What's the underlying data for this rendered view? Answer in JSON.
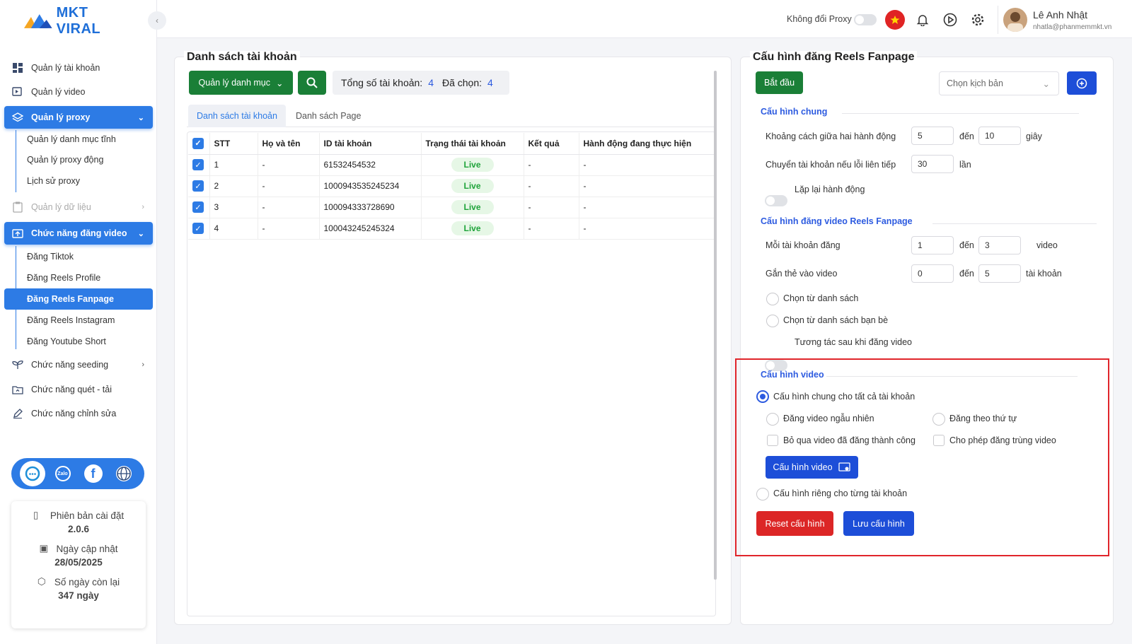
{
  "app": {
    "logo_text": "MKT VIRAL"
  },
  "sidebar": {
    "items": [
      {
        "label": "Quản lý tài khoản"
      },
      {
        "label": "Quản lý video"
      },
      {
        "label": "Quản lý proxy"
      },
      {
        "label": "Quản lý danh mục tĩnh"
      },
      {
        "label": "Quản lý proxy động"
      },
      {
        "label": "Lịch sử proxy"
      },
      {
        "label": "Quản lý dữ liệu"
      },
      {
        "label": "Chức năng đăng video"
      },
      {
        "label": "Đăng Tiktok"
      },
      {
        "label": "Đăng Reels Profile"
      },
      {
        "label": "Đăng Reels Fanpage"
      },
      {
        "label": "Đăng Reels Instagram"
      },
      {
        "label": "Đăng Youtube Short"
      },
      {
        "label": "Chức năng seeding"
      },
      {
        "label": "Chức năng quét - tải"
      },
      {
        "label": "Chức năng chỉnh sửa"
      }
    ],
    "social": {
      "zalo": "Zalo"
    },
    "info": {
      "version_label": "Phiên bản cài đặt",
      "version": "2.0.6",
      "update_label": "Ngày cập nhật",
      "update_date": "28/05/2025",
      "days_label": "Số ngày còn lại",
      "days": "347 ngày"
    }
  },
  "header": {
    "proxy_label": "Không đổi Proxy",
    "user_name": "Lê Anh Nhật",
    "user_email": "nhatla@phanmemmkt.vn"
  },
  "accounts": {
    "title": "Danh sách tài khoản",
    "category_btn": "Quản lý danh mục",
    "total_label": "Tổng số tài khoản:",
    "total": "4",
    "selected_label": "Đã chọn:",
    "selected": "4",
    "tabs": [
      "Danh sách tài khoản",
      "Danh sách Page"
    ],
    "columns": [
      "STT",
      "Họ và tên",
      "ID tài khoản",
      "Trạng thái tài khoản",
      "Kết quả",
      "Hành động đang thực hiện"
    ],
    "rows": [
      {
        "stt": "1",
        "name": "-",
        "id": "61532454532",
        "status": "Live",
        "result": "-",
        "action": "-"
      },
      {
        "stt": "2",
        "name": "-",
        "id": "1000943535245234",
        "status": "Live",
        "result": "-",
        "action": "-"
      },
      {
        "stt": "3",
        "name": "-",
        "id": "100094333728690",
        "status": "Live",
        "result": "-",
        "action": "-"
      },
      {
        "stt": "4",
        "name": "-",
        "id": "100043245245324",
        "status": "Live",
        "result": "-",
        "action": "-"
      }
    ]
  },
  "config": {
    "title": "Cấu hình đăng Reels Fanpage",
    "start_btn": "Bắt đầu",
    "script_placeholder": "Chọn kịch bản",
    "general": {
      "title": "Cấu hình chung",
      "delay_label": "Khoảng cách giữa hai hành động",
      "delay_from": "5",
      "to": "đến",
      "delay_to": "10",
      "delay_unit": "giây",
      "switch_label": "Chuyển tài khoản nếu lỗi liên tiếp",
      "switch_val": "30",
      "switch_unit": "lần",
      "repeat_label": "Lặp lại hành động"
    },
    "post": {
      "title": "Cấu hình đăng video Reels Fanpage",
      "per_acc_label": "Mỗi tài khoản đăng",
      "per_from": "1",
      "per_to": "3",
      "per_unit": "video",
      "tag_label": "Gắn thẻ vào video",
      "tag_from": "0",
      "tag_to": "5",
      "tag_unit": "tài khoản",
      "from_list": "Chọn từ danh sách",
      "from_friends": "Chọn từ danh sách bạn bè",
      "interact": "Tương tác sau khi đăng video"
    },
    "video": {
      "title": "Cấu hình video",
      "all_acc": "Cấu hình chung cho tất cả tài khoản",
      "random": "Đăng video ngẫu nhiên",
      "order": "Đăng theo thứ tự",
      "skip": "Bỏ qua video đã đăng thành công",
      "allow_dup": "Cho phép đăng trùng video",
      "video_btn": "Cấu hình video",
      "per_acc": "Cấu hình riêng cho từng tài khoản",
      "reset_btn": "Reset cấu hình",
      "save_btn": "Lưu cấu hình"
    }
  },
  "colors": {
    "accent": "#2d7be5",
    "green": "#1a7f37",
    "red": "#dc2626",
    "highlight": "#e0252b"
  }
}
